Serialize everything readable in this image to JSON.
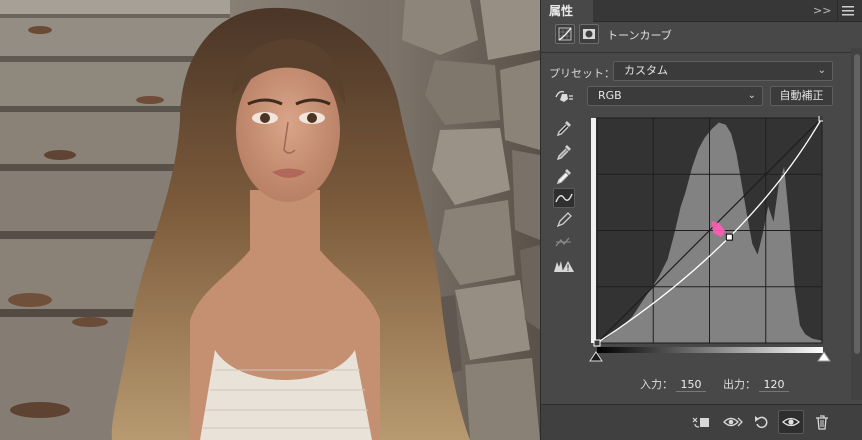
{
  "panel": {
    "tab_label": "属性",
    "collapse_glyph": ">>",
    "title": "トーンカーブ",
    "preset_label": "プリセット：",
    "preset_value": "カスタム",
    "channel_value": "RGB",
    "auto_button_label": "自動補正",
    "input_label": "入力：",
    "input_value": "150",
    "output_label": "出力：",
    "output_value": "120"
  },
  "curve": {
    "input_range": [
      0,
      255
    ],
    "output_range": [
      0,
      255
    ],
    "control_points": [
      [
        0,
        0
      ],
      [
        150,
        120
      ],
      [
        255,
        255
      ]
    ],
    "selected_point": [
      150,
      120
    ],
    "baseline_visible": true,
    "grid": "4x4"
  },
  "tools": {
    "left_column": [
      "target-adjust-icon",
      "black-point-eyedropper-icon",
      "gray-point-eyedropper-icon",
      "white-point-eyedropper-icon",
      "curve-point-tool-icon",
      "pencil-tool-icon",
      "smooth-icon",
      "clipping-warning-icon"
    ],
    "bottom_bar": [
      "clip-to-layer-icon",
      "view-previous-icon",
      "reset-icon",
      "visibility-eye-icon",
      "trash-icon"
    ]
  },
  "colors": {
    "panel_bg": "#484848",
    "graph_bg": "#333333",
    "histogram": "#828282",
    "curve_line": "#ffffff",
    "cursor_pink": "#ff5cb4"
  }
}
